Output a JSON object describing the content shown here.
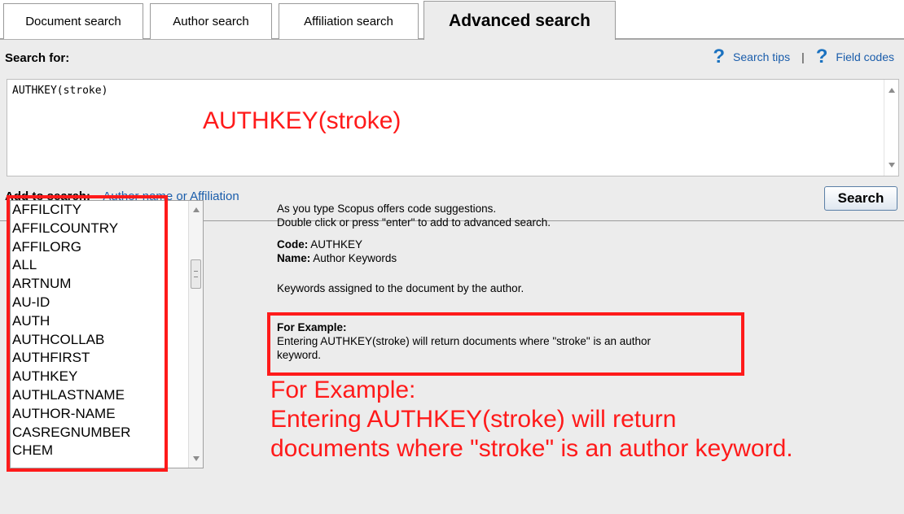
{
  "tabs": [
    {
      "label": "Document search"
    },
    {
      "label": "Author search"
    },
    {
      "label": "Affiliation search"
    },
    {
      "label": "Advanced search",
      "active": true
    }
  ],
  "search_for_label": "Search for:",
  "help": {
    "search_tips": "Search tips",
    "separator": "|",
    "field_codes": "Field codes",
    "icon_glyph": "?"
  },
  "query": {
    "value": "AUTHKEY(stroke)",
    "annotation": "AUTHKEY(stroke)"
  },
  "add_to_search": {
    "label": "Add to search:",
    "link": "Author name or Affiliation"
  },
  "search_button": "Search",
  "code_list": [
    "AFFILCITY",
    "AFFILCOUNTRY",
    "AFFILORG",
    "ALL",
    "ARTNUM",
    "AU-ID",
    "AUTH",
    "AUTHCOLLAB",
    "AUTHFIRST",
    "AUTHKEY",
    "AUTHLASTNAME",
    "AUTHOR-NAME",
    "CASREGNUMBER",
    "CHEM"
  ],
  "description": {
    "intro_line1": "As you type Scopus offers code suggestions.",
    "intro_line2": "Double click or press \"enter\" to add to advanced search.",
    "code_label": "Code:",
    "code_value": "AUTHKEY",
    "name_label": "Name:",
    "name_value": "Author Keywords",
    "summary": "Keywords assigned to the document by the author.",
    "example_title": "For Example:",
    "example_line1": "Entering AUTHKEY(stroke) will return documents where \"stroke\" is an author",
    "example_line2": "keyword."
  },
  "annotation": {
    "line1": "For Example:",
    "line2": "Entering AUTHKEY(stroke) will return",
    "line3": "documents where \"stroke\" is an author keyword."
  },
  "colors": {
    "annotation": "#ff1a1a",
    "link": "#1a5dab",
    "panel": "#ececec"
  }
}
